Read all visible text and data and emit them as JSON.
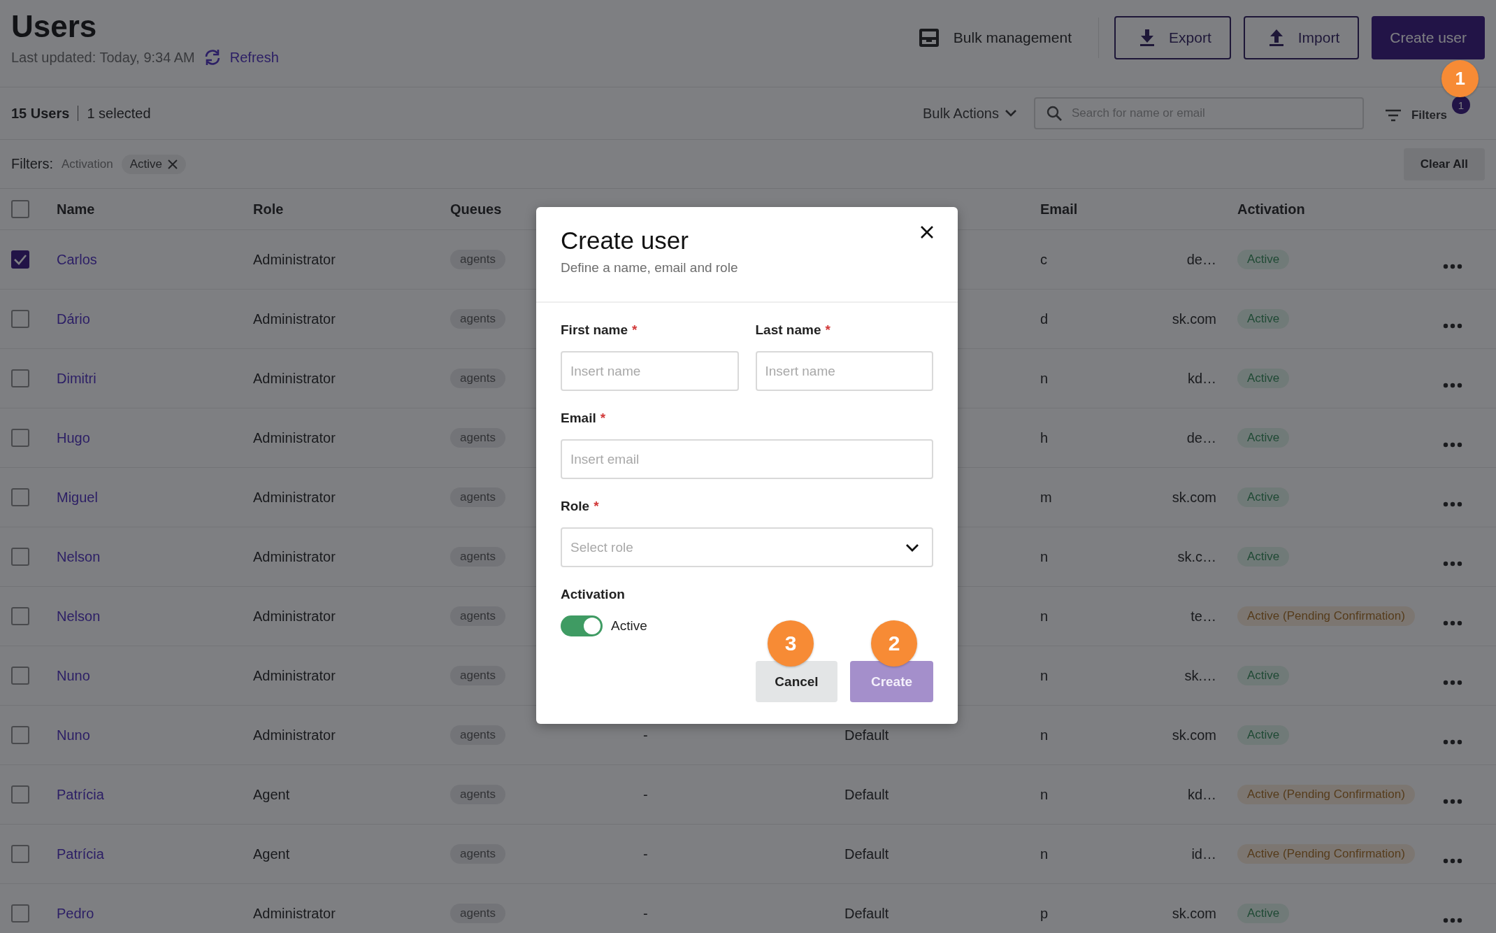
{
  "header": {
    "title": "Users",
    "last_updated": "Last updated: Today, 9:34 AM",
    "refresh": "Refresh",
    "actions": [
      {
        "label": "Bulk management",
        "kind": "link"
      },
      {
        "label": "Export",
        "kind": "outline"
      },
      {
        "label": "Import",
        "kind": "outline"
      },
      {
        "label": "Create user",
        "kind": "primary",
        "marker": "1"
      }
    ]
  },
  "toolbar": {
    "count": "15 Users",
    "selected": "1 selected",
    "bulk_actions": "Bulk Actions",
    "search": {
      "placeholder": "Search for name or email"
    },
    "filters": "Filters",
    "filters_badge": "1"
  },
  "filter_bar": {
    "label": "Filters:",
    "field": "Activation",
    "chips": [
      "Active"
    ],
    "clear": "Clear All"
  },
  "table": {
    "columns": [
      "Name",
      "Role",
      "Queues",
      "Email",
      "Activation"
    ],
    "all_checked": false,
    "rows": [
      {
        "checked": true,
        "name": "Carlos",
        "role": "Administrator",
        "queue": "agents",
        "email_start": "c",
        "email_end": "de…",
        "activation": "Active",
        "kind": "active"
      },
      {
        "checked": false,
        "name": "Dário",
        "role": "Administrator",
        "queue": "agents",
        "email_start": "d",
        "email_end": "sk.com",
        "activation": "Active",
        "kind": "active"
      },
      {
        "checked": false,
        "name": "Dimitri",
        "role": "Administrator",
        "queue": "agents",
        "email_start": "n",
        "email_end": "kd…",
        "activation": "Active",
        "kind": "active"
      },
      {
        "checked": false,
        "name": "Hugo",
        "role": "Administrator",
        "queue": "agents",
        "email_start": "h",
        "email_end": "de…",
        "activation": "Active",
        "kind": "active"
      },
      {
        "checked": false,
        "name": "Miguel",
        "role": "Administrator",
        "queue": "agents",
        "email_start": "m",
        "email_end": "sk.com",
        "activation": "Active",
        "kind": "active"
      },
      {
        "checked": false,
        "name": "Nelson",
        "role": "Administrator",
        "queue": "agents",
        "email_start": "n",
        "email_end": "sk.c…",
        "activation": "Active",
        "kind": "active"
      },
      {
        "checked": false,
        "name": "Nelson",
        "role": "Administrator",
        "queue": "agents",
        "email_start": "n",
        "email_end": "te…",
        "activation": "Active (Pending Confirmation)",
        "kind": "pending"
      },
      {
        "checked": false,
        "name": "Nuno",
        "role": "Administrator",
        "queue": "agents",
        "email_start": "n",
        "email_end": "sk.…",
        "activation": "Active",
        "kind": "active"
      },
      {
        "checked": false,
        "name": "Nuno",
        "role": "Administrator",
        "queue": "agents",
        "column_4": "-",
        "column_5": "Default",
        "email_start": "n",
        "email_end": "sk.com",
        "activation": "Active",
        "kind": "active"
      },
      {
        "checked": false,
        "name": "Patrícia",
        "role": "Agent",
        "queue": "agents",
        "column_4": "-",
        "column_5": "Default",
        "email_start": "n",
        "email_end": "kd…",
        "activation": "Active (Pending Confirmation)",
        "kind": "pending"
      },
      {
        "checked": false,
        "name": "Patrícia",
        "role": "Agent",
        "queue": "agents",
        "column_4": "-",
        "column_5": "Default",
        "email_start": "n",
        "email_end": "id…",
        "activation": "Active (Pending Confirmation)",
        "kind": "pending"
      },
      {
        "checked": false,
        "name": "Pedro",
        "role": "Administrator",
        "queue": "agents",
        "column_4": "-",
        "column_5": "Default",
        "email_start": "p",
        "email_end": "sk.com",
        "activation": "Active",
        "kind": "active"
      }
    ]
  },
  "modal": {
    "title": "Create user",
    "subtitle": "Define a name, email and role",
    "field_rows": [
      [
        {
          "label": "First name",
          "mark": "*",
          "placeholder": "Insert name",
          "kind": "text"
        },
        {
          "label": "Last name",
          "mark": "*",
          "placeholder": "Insert name",
          "kind": "text"
        }
      ],
      [
        {
          "label": "Email",
          "mark": "*",
          "placeholder": "Insert email",
          "kind": "text"
        }
      ],
      [
        {
          "label": "Role",
          "mark": "*",
          "placeholder": "Select role",
          "kind": "select"
        }
      ]
    ],
    "activation": {
      "label": "Activation",
      "on": true,
      "text": "Active"
    },
    "buttons": [
      {
        "label": "Cancel",
        "kind": "secondary",
        "disabled": false,
        "marker": "3"
      },
      {
        "label": "Create",
        "kind": "primary",
        "disabled": true,
        "marker": "2"
      }
    ]
  }
}
